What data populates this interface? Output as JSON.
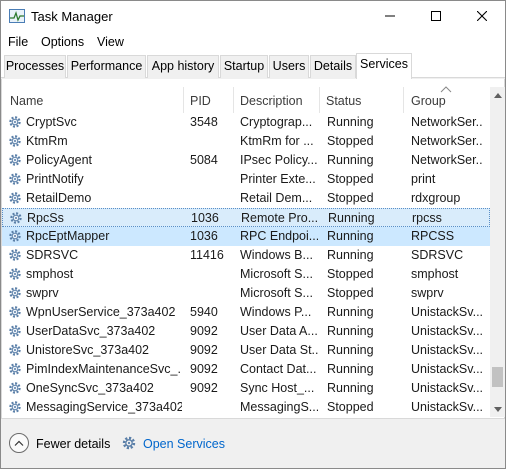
{
  "window": {
    "title": "Task Manager"
  },
  "menu": [
    "File",
    "Options",
    "View"
  ],
  "tabs": [
    {
      "label": "Processes",
      "active": false
    },
    {
      "label": "Performance",
      "active": false
    },
    {
      "label": "App history",
      "active": false
    },
    {
      "label": "Startup",
      "active": false
    },
    {
      "label": "Users",
      "active": false
    },
    {
      "label": "Details",
      "active": false
    },
    {
      "label": "Services",
      "active": true
    }
  ],
  "table": {
    "columns": [
      "Name",
      "PID",
      "Description",
      "Status",
      "Group"
    ],
    "sorted_column": "Group",
    "rows": [
      {
        "name": "CryptSvc",
        "pid": "3548",
        "description": "Cryptograp...",
        "status": "Running",
        "group": "NetworkSer..."
      },
      {
        "name": "KtmRm",
        "pid": "",
        "description": "KtmRm for ...",
        "status": "Stopped",
        "group": "NetworkSer..."
      },
      {
        "name": "PolicyAgent",
        "pid": "5084",
        "description": "IPsec Policy...",
        "status": "Running",
        "group": "NetworkSer..."
      },
      {
        "name": "PrintNotify",
        "pid": "",
        "description": "Printer Exte...",
        "status": "Stopped",
        "group": "print"
      },
      {
        "name": "RetailDemo",
        "pid": "",
        "description": "Retail Dem...",
        "status": "Stopped",
        "group": "rdxgroup"
      },
      {
        "name": "RpcSs",
        "pid": "1036",
        "description": "Remote Pro...",
        "status": "Running",
        "group": "rpcss",
        "state": "focus"
      },
      {
        "name": "RpcEptMapper",
        "pid": "1036",
        "description": "RPC Endpoi...",
        "status": "Running",
        "group": "RPCSS",
        "state": "selected"
      },
      {
        "name": "SDRSVC",
        "pid": "11416",
        "description": "Windows B...",
        "status": "Running",
        "group": "SDRSVC"
      },
      {
        "name": "smphost",
        "pid": "",
        "description": "Microsoft S...",
        "status": "Stopped",
        "group": "smphost"
      },
      {
        "name": "swprv",
        "pid": "",
        "description": "Microsoft S...",
        "status": "Stopped",
        "group": "swprv"
      },
      {
        "name": "WpnUserService_373a402",
        "pid": "5940",
        "description": "Windows P...",
        "status": "Running",
        "group": "UnistackSv..."
      },
      {
        "name": "UserDataSvc_373a402",
        "pid": "9092",
        "description": "User Data A...",
        "status": "Running",
        "group": "UnistackSv..."
      },
      {
        "name": "UnistoreSvc_373a402",
        "pid": "9092",
        "description": "User Data St...",
        "status": "Running",
        "group": "UnistackSv..."
      },
      {
        "name": "PimIndexMaintenanceSvc_...",
        "pid": "9092",
        "description": "Contact Dat...",
        "status": "Running",
        "group": "UnistackSv..."
      },
      {
        "name": "OneSyncSvc_373a402",
        "pid": "9092",
        "description": "Sync Host_...",
        "status": "Running",
        "group": "UnistackSv..."
      },
      {
        "name": "MessagingService_373a402",
        "pid": "",
        "description": "MessagingS...",
        "status": "Stopped",
        "group": "UnistackSv..."
      }
    ]
  },
  "footer": {
    "fewer_details": "Fewer details",
    "open_services": "Open Services"
  },
  "colors": {
    "selected_row": "#cce8ff",
    "link": "#0066cc",
    "gear": "#5a7fa8"
  },
  "icons": {
    "app": "task-manager-icon",
    "service": "gear-icon",
    "fewer": "chevron-up-icon",
    "open_services": "services-gear-icon"
  }
}
